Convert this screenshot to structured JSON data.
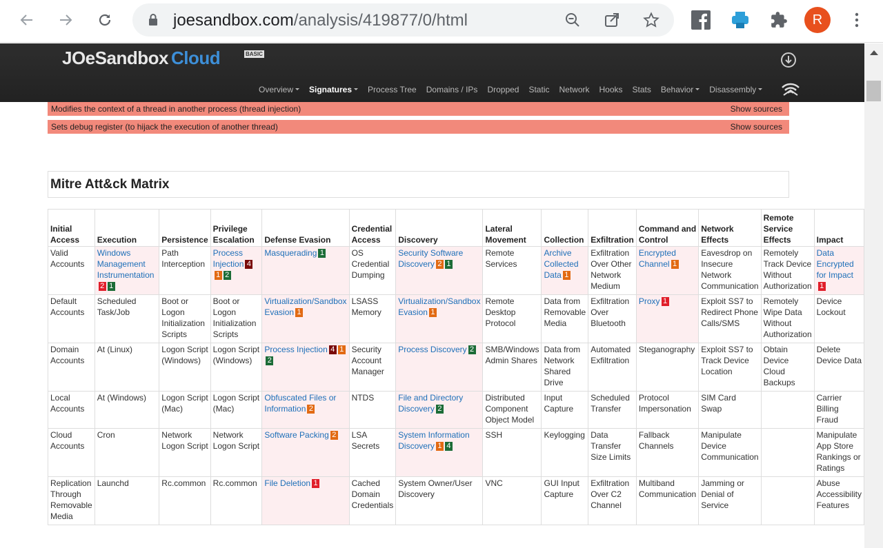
{
  "browser": {
    "url_host": "joesandbox.com",
    "url_path": "/analysis/419877/0/html",
    "avatar_letter": "R"
  },
  "site": {
    "logo_main": "JOeSandbox",
    "logo_cloud": "Cloud",
    "logo_badge": "BASIC",
    "nav": [
      "Overview",
      "Signatures",
      "Process Tree",
      "Domains / IPs",
      "Dropped",
      "Static",
      "Network",
      "Hooks",
      "Stats",
      "Behavior",
      "Disassembly"
    ]
  },
  "signatures": [
    {
      "text": "Modifies the context of a thread in another process (thread injection)",
      "action": "Show sources"
    },
    {
      "text": "Sets debug register (to hijack the execution of another thread)",
      "action": "Show sources"
    }
  ],
  "mitre": {
    "title": "Mitre Att&ck Matrix",
    "headers": [
      "Initial Access",
      "Execution",
      "Persistence",
      "Privilege Escalation",
      "Defense Evasion",
      "Credential Access",
      "Discovery",
      "Lateral Movement",
      "Collection",
      "Exfiltration",
      "Command and Control",
      "Network Effects",
      "Remote Service Effects",
      "Impact"
    ],
    "rows": [
      [
        {
          "t": "Valid Accounts"
        },
        {
          "t": "Windows Management Instrumentation",
          "link": true,
          "hl": true,
          "badges": [
            [
              "2",
              "r"
            ],
            [
              "1",
              "g"
            ]
          ]
        },
        {
          "t": "Path Interception"
        },
        {
          "t": "Process Injection",
          "link": true,
          "hl": true,
          "badges": [
            [
              "4",
              "dr"
            ],
            [
              "1",
              "o"
            ],
            [
              "2",
              "g"
            ]
          ]
        },
        {
          "t": "Masquerading",
          "link": true,
          "hl": true,
          "badges": [
            [
              "1",
              "g"
            ]
          ]
        },
        {
          "t": "OS Credential Dumping"
        },
        {
          "t": "Security Software Discovery",
          "link": true,
          "hl": true,
          "badges": [
            [
              "2",
              "o"
            ],
            [
              "1",
              "g"
            ]
          ]
        },
        {
          "t": "Remote Services"
        },
        {
          "t": "Archive Collected Data",
          "link": true,
          "hl": true,
          "badges": [
            [
              "1",
              "o"
            ]
          ]
        },
        {
          "t": "Exfiltration Over Other Network Medium"
        },
        {
          "t": "Encrypted Channel",
          "link": true,
          "hl": true,
          "badges": [
            [
              "1",
              "o"
            ]
          ]
        },
        {
          "t": "Eavesdrop on Insecure Network Communication"
        },
        {
          "t": "Remotely Track Device Without Authorization"
        },
        {
          "t": "Data Encrypted for Impact",
          "link": true,
          "hl": true,
          "badges": [
            [
              "1",
              "r"
            ]
          ]
        }
      ],
      [
        {
          "t": "Default Accounts"
        },
        {
          "t": "Scheduled Task/Job"
        },
        {
          "t": "Boot or Logon Initialization Scripts"
        },
        {
          "t": "Boot or Logon Initialization Scripts"
        },
        {
          "t": "Virtualization/Sandbox Evasion",
          "link": true,
          "hl": true,
          "badges": [
            [
              "1",
              "o"
            ]
          ]
        },
        {
          "t": "LSASS Memory"
        },
        {
          "t": "Virtualization/Sandbox Evasion",
          "link": true,
          "hl": true,
          "badges": [
            [
              "1",
              "o"
            ]
          ]
        },
        {
          "t": "Remote Desktop Protocol"
        },
        {
          "t": "Data from Removable Media"
        },
        {
          "t": "Exfiltration Over Bluetooth"
        },
        {
          "t": "Proxy",
          "link": true,
          "hl": true,
          "badges": [
            [
              "1",
              "r"
            ]
          ]
        },
        {
          "t": "Exploit SS7 to Redirect Phone Calls/SMS"
        },
        {
          "t": "Remotely Wipe Data Without Authorization"
        },
        {
          "t": "Device Lockout"
        }
      ],
      [
        {
          "t": "Domain Accounts"
        },
        {
          "t": "At (Linux)"
        },
        {
          "t": "Logon Script (Windows)"
        },
        {
          "t": "Logon Script (Windows)"
        },
        {
          "t": "Process Injection",
          "link": true,
          "hl": true,
          "badges": [
            [
              "4",
              "dr"
            ],
            [
              "1",
              "o"
            ],
            [
              "2",
              "g"
            ]
          ]
        },
        {
          "t": "Security Account Manager"
        },
        {
          "t": "Process Discovery",
          "link": true,
          "hl": true,
          "badges": [
            [
              "2",
              "g"
            ]
          ]
        },
        {
          "t": "SMB/Windows Admin Shares"
        },
        {
          "t": "Data from Network Shared Drive"
        },
        {
          "t": "Automated Exfiltration"
        },
        {
          "t": "Steganography"
        },
        {
          "t": "Exploit SS7 to Track Device Location"
        },
        {
          "t": "Obtain Device Cloud Backups"
        },
        {
          "t": "Delete Device Data"
        }
      ],
      [
        {
          "t": "Local Accounts"
        },
        {
          "t": "At (Windows)"
        },
        {
          "t": "Logon Script (Mac)"
        },
        {
          "t": "Logon Script (Mac)"
        },
        {
          "t": "Obfuscated Files or Information",
          "link": true,
          "hl": true,
          "badges": [
            [
              "2",
              "o"
            ]
          ]
        },
        {
          "t": "NTDS"
        },
        {
          "t": "File and Directory Discovery",
          "link": true,
          "hl": true,
          "badges": [
            [
              "2",
              "g"
            ]
          ]
        },
        {
          "t": "Distributed Component Object Model"
        },
        {
          "t": "Input Capture"
        },
        {
          "t": "Scheduled Transfer"
        },
        {
          "t": "Protocol Impersonation"
        },
        {
          "t": "SIM Card Swap"
        },
        {
          "t": ""
        },
        {
          "t": "Carrier Billing Fraud"
        }
      ],
      [
        {
          "t": "Cloud Accounts"
        },
        {
          "t": "Cron"
        },
        {
          "t": "Network Logon Script"
        },
        {
          "t": "Network Logon Script"
        },
        {
          "t": "Software Packing",
          "link": true,
          "hl": true,
          "badges": [
            [
              "2",
              "o"
            ]
          ]
        },
        {
          "t": "LSA Secrets"
        },
        {
          "t": "System Information Discovery",
          "link": true,
          "hl": true,
          "badges": [
            [
              "1",
              "o"
            ],
            [
              "4",
              "g"
            ]
          ]
        },
        {
          "t": "SSH"
        },
        {
          "t": "Keylogging"
        },
        {
          "t": "Data Transfer Size Limits"
        },
        {
          "t": "Fallback Channels"
        },
        {
          "t": "Manipulate Device Communication"
        },
        {
          "t": ""
        },
        {
          "t": "Manipulate App Store Rankings or Ratings"
        }
      ],
      [
        {
          "t": "Replication Through Removable Media"
        },
        {
          "t": "Launchd"
        },
        {
          "t": "Rc.common"
        },
        {
          "t": "Rc.common"
        },
        {
          "t": "File Deletion",
          "link": true,
          "hl": true,
          "badges": [
            [
              "1",
              "r"
            ]
          ]
        },
        {
          "t": "Cached Domain Credentials"
        },
        {
          "t": "System Owner/User Discovery"
        },
        {
          "t": "VNC"
        },
        {
          "t": "GUI Input Capture"
        },
        {
          "t": "Exfiltration Over C2 Channel"
        },
        {
          "t": "Multiband Communication"
        },
        {
          "t": "Jamming or Denial of Service"
        },
        {
          "t": ""
        },
        {
          "t": "Abuse Accessibility Features"
        }
      ]
    ]
  }
}
